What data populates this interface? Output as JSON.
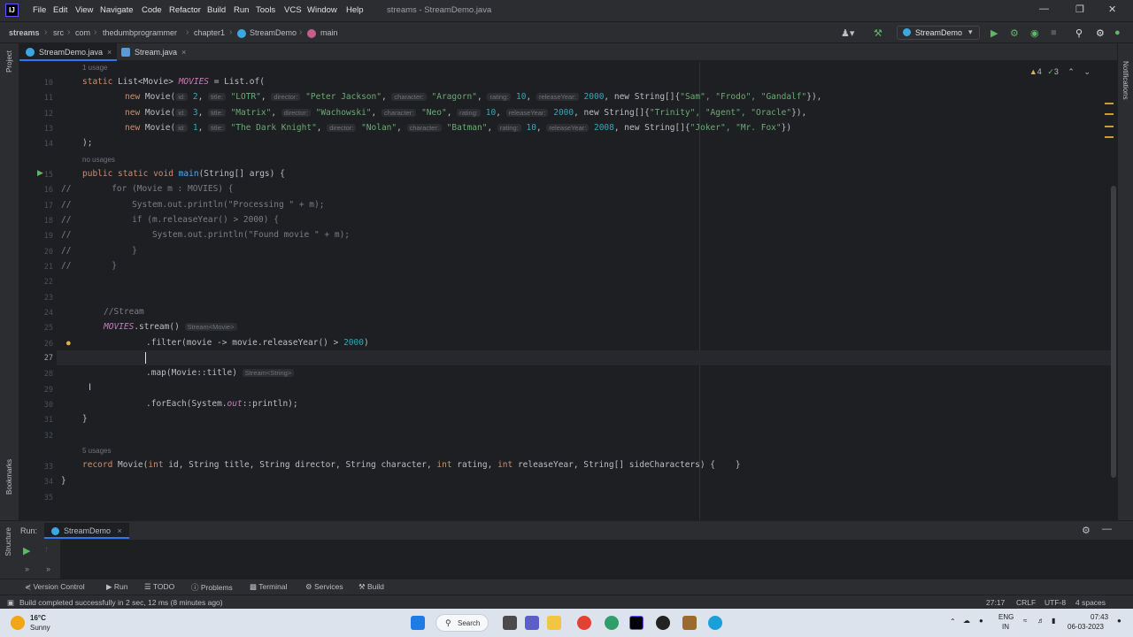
{
  "menubar": {
    "items": [
      "File",
      "Edit",
      "View",
      "Navigate",
      "Code",
      "Refactor",
      "Build",
      "Run",
      "Tools",
      "VCS",
      "Window",
      "Help"
    ],
    "title": "streams - StreamDemo.java"
  },
  "breadcrumbs": [
    "streams",
    "src",
    "com",
    "thedumbprogrammer",
    "chapter1",
    "StreamDemo",
    "main"
  ],
  "run_config": "StreamDemo",
  "tabs": [
    {
      "label": "StreamDemo.java",
      "active": true
    },
    {
      "label": "Stream.java",
      "active": false
    }
  ],
  "inspections": {
    "warnings": "4",
    "weak": "3"
  },
  "usages": {
    "movies": "1 usage",
    "main": "no usages",
    "record": "5 usages"
  },
  "line_numbers": [
    "10",
    "11",
    "12",
    "13",
    "14",
    "15",
    "16",
    "17",
    "18",
    "19",
    "20",
    "21",
    "22",
    "23",
    "24",
    "25",
    "26",
    "27",
    "28",
    "29",
    "30",
    "31",
    "32",
    "33",
    "34",
    "35"
  ],
  "code": {
    "l10": {
      "a": "static ",
      "b": "List<Movie> ",
      "c": "MOVIES",
      "d": " = List.",
      "e": "of("
    },
    "l11": {
      "a": "new ",
      "b": "Movie(",
      "h_id": "id:",
      "n1": "2",
      "h_title": "title:",
      "s1": "\"LOTR\"",
      "h_dir": "director:",
      "s2": "\"Peter Jackson\"",
      "h_char": "character:",
      "s3": "\"Aragorn\"",
      "h_rat": "rating:",
      "n2": "10",
      "h_year": "releaseYear:",
      "n3": "2000",
      "x": ", new String[]{",
      "s4": "\"Sam\", \"Frodo\", \"Gandalf\"",
      "end": "}),"
    },
    "l12": {
      "a": "new ",
      "b": "Movie(",
      "h_id": "id:",
      "n1": "3",
      "h_title": "title:",
      "s1": "\"Matrix\"",
      "h_dir": "director:",
      "s2": "\"Wachowski\"",
      "h_char": "character:",
      "s3": "\"Neo\"",
      "h_rat": "rating:",
      "n2": "10",
      "h_year": "releaseYear:",
      "n3": "2000",
      "x": ", new String[]{",
      "s4": "\"Trinity\", \"Agent\", \"Oracle\"",
      "end": "}),"
    },
    "l13": {
      "a": "new ",
      "b": "Movie(",
      "h_id": "id:",
      "n1": "1",
      "h_title": "title:",
      "s1": "\"The Dark Knight\"",
      "h_dir": "director:",
      "s2": "\"Nolan\"",
      "h_char": "character:",
      "s3": "\"Batman\"",
      "h_rat": "rating:",
      "n2": "10",
      "h_year": "releaseYear:",
      "n3": "2008",
      "x": ", new String[]{",
      "s4": "\"Joker\", \"Mr. Fox\"",
      "end": "})"
    },
    "l14": ");",
    "l15": {
      "a": "public static void ",
      "b": "main",
      "c": "(String[] args) {"
    },
    "l16": "//        for (Movie m : MOVIES) {",
    "l17": "//            System.out.println(\"Processing \" + m);",
    "l18": "//            if (m.releaseYear() > 2000) {",
    "l19": "//                System.out.println(\"Found movie \" + m);",
    "l20": "//            }",
    "l21": "//        }",
    "l24": "//Stream",
    "l25": {
      "a": "MOVIES",
      "b": ".stream()",
      "hint": "Stream<Movie>"
    },
    "l26": {
      "a": ".filter(movie -> movie.releaseYear() > ",
      "n": "2000",
      "b": ")"
    },
    "l28": {
      "a": ".map(Movie::title)",
      "hint": "Stream<String>"
    },
    "l30": {
      "a": ".forEach(System.",
      "b": "out",
      "c": "::println);"
    },
    "l31": "}",
    "l33": {
      "a": "record ",
      "b": "Movie(",
      "k1": "int ",
      "c": "id, String title, String director, String character, ",
      "k2": "int ",
      "d": "rating, ",
      "k3": "int ",
      "e": "releaseYear, String[] sideCharacters) {    }"
    },
    "l34": "}"
  },
  "side_labels": {
    "project": "Project",
    "bookmarks": "Bookmarks",
    "structure": "Structure",
    "notifications": "Notifications"
  },
  "run_panel": {
    "label": "Run:",
    "tab": "StreamDemo"
  },
  "tool_windows": [
    "Version Control",
    "Run",
    "TODO",
    "Problems",
    "Terminal",
    "Services",
    "Build"
  ],
  "status": {
    "message": "Build completed successfully in 2 sec, 12 ms (8 minutes ago)",
    "position": "27:17",
    "line_sep": "CRLF",
    "encoding": "UTF-8",
    "indent": "4 spaces"
  },
  "taskbar": {
    "weather_temp": "16°C",
    "weather_desc": "Sunny",
    "search": "Search",
    "lang1": "ENG",
    "lang2": "IN",
    "time": "07:43",
    "date": "06-03-2023"
  }
}
